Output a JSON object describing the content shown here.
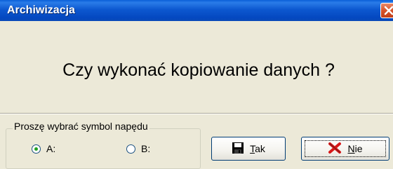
{
  "window": {
    "title": "Archiwizacja"
  },
  "dialog": {
    "question": "Czy wykonać kopiowanie danych ?"
  },
  "drive_group": {
    "legend": "Proszę wybrać symbol napędu",
    "options": [
      {
        "label": "A:",
        "selected": true
      },
      {
        "label": "B:",
        "selected": false
      }
    ]
  },
  "buttons": {
    "yes": {
      "accel": "T",
      "rest": "ak",
      "icon": "floppy-disk-icon"
    },
    "no": {
      "accel": "N",
      "rest": "ie",
      "icon": "red-x-icon",
      "focused": true
    }
  },
  "colors": {
    "titlebar": "#0a5fd8",
    "dialog_bg": "#ece9d8",
    "close_button": "#d8532a",
    "radio_dot": "#21a121",
    "no_icon": "#d81818"
  }
}
